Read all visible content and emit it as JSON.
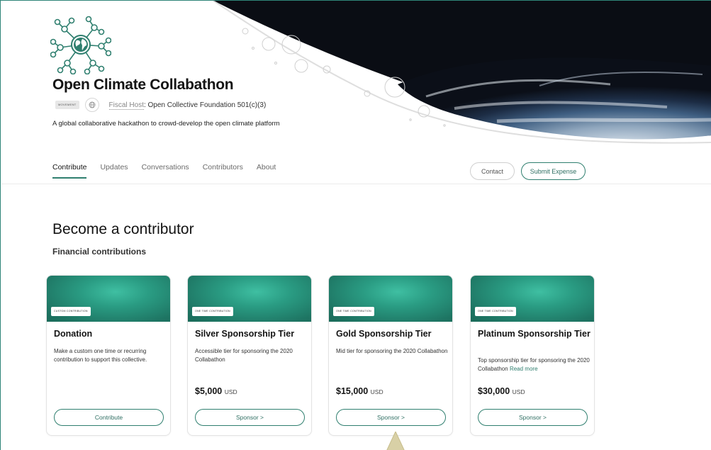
{
  "collective": {
    "name": "Open Climate Collabathon",
    "type_badge": "MOVEMENT",
    "fiscal_host_label": "Fiscal Host",
    "fiscal_host_value": "Open Collective Foundation 501(c)(3)",
    "description": "A global collaborative hackathon to crowd-develop the open climate platform"
  },
  "tabs": [
    {
      "label": "Contribute",
      "active": true
    },
    {
      "label": "Updates",
      "active": false
    },
    {
      "label": "Conversations",
      "active": false
    },
    {
      "label": "Contributors",
      "active": false
    },
    {
      "label": "About",
      "active": false
    }
  ],
  "actions": {
    "contact": "Contact",
    "submit_expense": "Submit Expense"
  },
  "section": {
    "title": "Become a contributor",
    "subtitle": "Financial contributions"
  },
  "tiers": [
    {
      "tag": "CUSTOM CONTRIBUTION",
      "title": "Donation",
      "description": "Make a custom one time or recurring contribution to support this collective.",
      "read_more": "",
      "amount": "",
      "currency": "",
      "button": "Contribute"
    },
    {
      "tag": "ONE TIME CONTRIBUTION",
      "title": "Silver Sponsorship Tier",
      "description": "Accessible tier for sponsoring the 2020 Collabathon",
      "read_more": "",
      "amount": "$5,000",
      "currency": "USD",
      "button": "Sponsor >"
    },
    {
      "tag": "ONE TIME CONTRIBUTION",
      "title": "Gold Sponsorship Tier",
      "description": "Mid tier for sponsoring the 2020 Collabathon",
      "read_more": "",
      "amount": "$15,000",
      "currency": "USD",
      "button": "Sponsor >"
    },
    {
      "tag": "ONE TIME CONTRIBUTION",
      "title": "Platinum Sponsorship Tier",
      "description": "Top sponsorship tier for sponsoring the 2020 Collabathon",
      "read_more": "Read more",
      "amount": "$30,000",
      "currency": "USD",
      "button": "Sponsor >"
    }
  ],
  "colors": {
    "brand": "#2f7f6f",
    "card_header": "#2a9c83",
    "frame_border": "#2f8478"
  }
}
